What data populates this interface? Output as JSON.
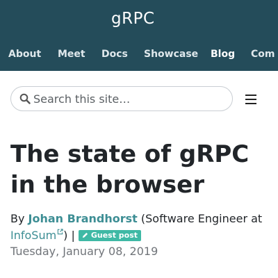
{
  "header": {
    "logo_text": "gRPC",
    "nav": [
      "About",
      "Meet",
      "Docs",
      "Showcase",
      "Blog",
      "Com"
    ],
    "active_nav": "Blog",
    "bg_color": "#244c5a"
  },
  "search": {
    "placeholder": "Search this site…",
    "icon": "search-icon"
  },
  "menu": {
    "icon": "hamburger-menu-icon"
  },
  "article": {
    "title": "The state of gRPC in the browser",
    "by_prefix": "By",
    "author": "Johan Brandhorst",
    "role_before_link": "(Software Engineer at",
    "company": "InfoSum",
    "after_company": ") |",
    "badge": "Guest post",
    "date": "Tuesday, January 08, 2019",
    "link_color": "#3d8e94",
    "badge_color": "#3fb9a5"
  }
}
